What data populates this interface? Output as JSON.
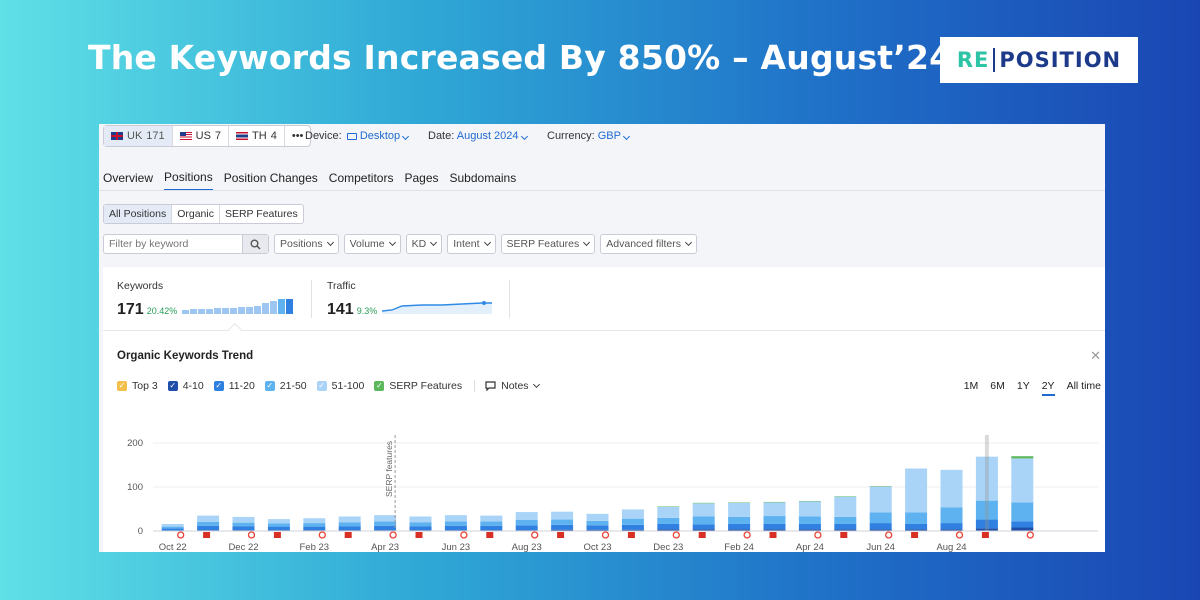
{
  "headline": "The Keywords Increased By 850% – August’24",
  "logo": {
    "left": "RE",
    "right": "POSITION"
  },
  "databases": [
    {
      "flag": "uk",
      "code": "UK",
      "count": "171"
    },
    {
      "flag": "us",
      "code": "US",
      "count": "7"
    },
    {
      "flag": "th",
      "code": "TH",
      "count": "4"
    }
  ],
  "more_label": "•••",
  "device": {
    "label": "Device:",
    "value": "Desktop"
  },
  "date": {
    "label": "Date:",
    "value": "August 2024"
  },
  "currency": {
    "label": "Currency:",
    "value": "GBP"
  },
  "tabs": [
    "Overview",
    "Positions",
    "Position Changes",
    "Competitors",
    "Pages",
    "Subdomains"
  ],
  "active_tab": "Positions",
  "segments": [
    "All Positions",
    "Organic",
    "SERP Features"
  ],
  "search_placeholder": "Filter by keyword",
  "filters": [
    "Positions",
    "Volume",
    "KD",
    "Intent",
    "SERP Features",
    "Advanced filters"
  ],
  "keywords": {
    "label": "Keywords",
    "value": "171",
    "change": "20.42%"
  },
  "traffic": {
    "label": "Traffic",
    "value": "141",
    "change": "9.3%"
  },
  "chart_title": "Organic Keywords Trend",
  "legend": [
    {
      "label": "Top 3",
      "color": "#f3c04a"
    },
    {
      "label": "4-10",
      "color": "#1f4fa8"
    },
    {
      "label": "11-20",
      "color": "#2f80e0"
    },
    {
      "label": "21-50",
      "color": "#5fb2f0"
    },
    {
      "label": "51-100",
      "color": "#a9d4f8"
    },
    {
      "label": "SERP Features",
      "color": "#5cb85c"
    }
  ],
  "notes_label": "Notes",
  "periods": [
    "1M",
    "6M",
    "1Y",
    "2Y",
    "All time"
  ],
  "active_period": "2Y",
  "chart_data": {
    "type": "bar",
    "stacked": true,
    "ylim": [
      0,
      200
    ],
    "yticks": [
      0,
      100,
      200
    ],
    "annotation": "SERP features",
    "x_tick_labels": [
      "Oct 22",
      "Dec 22",
      "Feb 23",
      "Apr 23",
      "Jun 23",
      "Aug 23",
      "Oct 23",
      "Dec 23",
      "Feb 24",
      "Apr 24",
      "Jun 24",
      "Aug 24"
    ],
    "series": [
      {
        "name": "Top 3",
        "values": [
          0,
          0,
          0,
          0,
          0,
          0,
          0,
          0,
          0,
          0,
          0,
          0,
          0,
          0,
          0,
          0,
          0,
          0,
          0,
          0,
          0,
          0,
          0,
          0,
          0
        ]
      },
      {
        "name": "4-10",
        "values": [
          1,
          2,
          2,
          2,
          2,
          2,
          2,
          2,
          2,
          2,
          2,
          3,
          3,
          3,
          4,
          4,
          4,
          4,
          4,
          4,
          4,
          4,
          4,
          6,
          8
        ]
      },
      {
        "name": "11-20",
        "values": [
          5,
          10,
          9,
          8,
          8,
          9,
          10,
          9,
          10,
          10,
          11,
          11,
          10,
          11,
          12,
          11,
          12,
          12,
          12,
          12,
          14,
          12,
          14,
          20,
          14
        ]
      },
      {
        "name": "21-50",
        "values": [
          4,
          9,
          8,
          7,
          8,
          9,
          10,
          9,
          10,
          10,
          12,
          12,
          10,
          14,
          14,
          18,
          16,
          18,
          17,
          16,
          24,
          26,
          36,
          43,
          43
        ]
      },
      {
        "name": "51-100",
        "values": [
          6,
          14,
          13,
          10,
          11,
          13,
          14,
          13,
          14,
          13,
          18,
          18,
          16,
          21,
          25,
          30,
          32,
          31,
          34,
          46,
          59,
          100,
          85,
          100,
          100
        ]
      },
      {
        "name": "SERP Features",
        "values": [
          0,
          0,
          0,
          0,
          0,
          0,
          0,
          0,
          0,
          0,
          0,
          0,
          0,
          0,
          1,
          1,
          1,
          1,
          1,
          1,
          1,
          0,
          0,
          0,
          5
        ]
      }
    ]
  }
}
